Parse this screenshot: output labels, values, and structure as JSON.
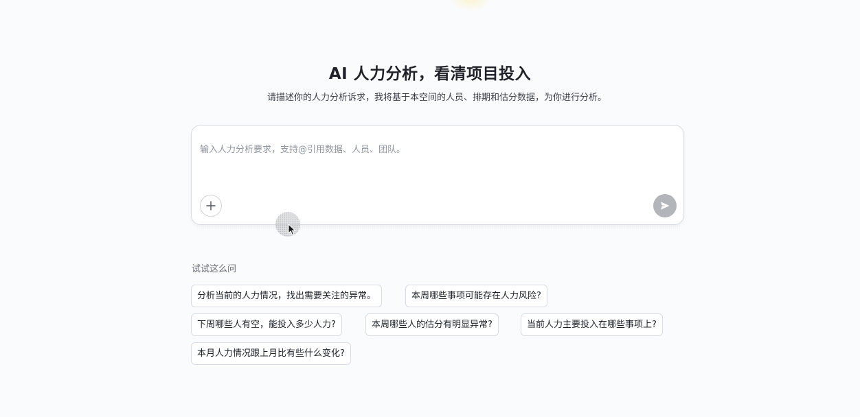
{
  "hero": {
    "title": "AI 人力分析，看清项目投入",
    "subtitle": "请描述你的人力分析诉求，我将基于本空间的人员、排期和估分数据，为你进行分析。"
  },
  "composer": {
    "placeholder": "输入人力分析要求，支持@引用数据、人员、团队。",
    "value": "",
    "add_icon": "plus-icon",
    "send_icon": "send-icon"
  },
  "suggestions": {
    "label": "试试这么问",
    "items": [
      "分析当前的人力情况，找出需要关注的异常。",
      "本周哪些事项可能存在人力风险?",
      "下周哪些人有空，能投入多少人力?",
      "本周哪些人的估分有明显异常?",
      "当前人力主要投入在哪些事项上?",
      "本月人力情况跟上月比有些什么变化?"
    ]
  },
  "colors": {
    "background": "#fafbfc",
    "send_button": "#b2b5ba",
    "border": "#d7dae0",
    "text_primary": "#1f2329",
    "text_secondary": "#646a73",
    "placeholder": "#8f959e"
  }
}
